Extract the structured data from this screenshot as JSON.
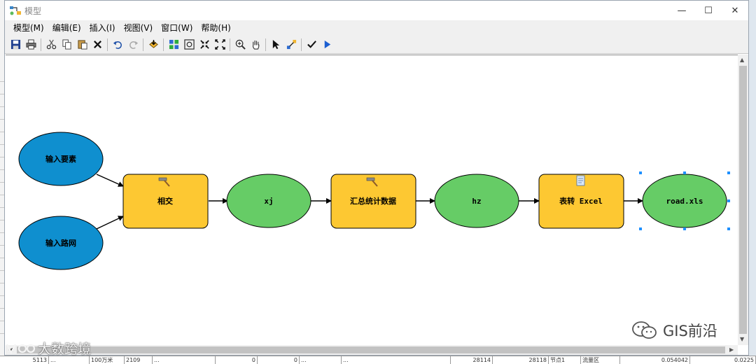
{
  "window": {
    "title": "模型",
    "minimize": "—",
    "maximize": "☐",
    "close": "✕"
  },
  "menu": [
    "模型(M)",
    "编辑(E)",
    "插入(I)",
    "视图(V)",
    "窗口(W)",
    "帮助(H)"
  ],
  "toolbar": {
    "groups": [
      [
        "save-icon",
        "print-icon"
      ],
      [
        "cut-icon",
        "copy-icon",
        "paste-icon",
        "delete-icon"
      ],
      [
        "undo-icon",
        "redo-icon"
      ],
      [
        "add-data-icon"
      ],
      [
        "auto-layout-icon",
        "full-extent-icon",
        "fixed-zoom-in-icon",
        "fixed-zoom-out-icon"
      ],
      [
        "zoom-in-icon",
        "pan-icon"
      ],
      [
        "select-icon",
        "connect-icon"
      ],
      [
        "validate-icon",
        "run-icon"
      ]
    ]
  },
  "colors": {
    "input_blue": "#0f8fcf",
    "tool_orange": "#fdc832",
    "output_green": "#66cc66",
    "selection": "#1e90ff"
  },
  "model": {
    "inputs": [
      "输入要素",
      "输入路网"
    ],
    "tools": [
      "相交",
      "汇总统计数据",
      "表转 Excel"
    ],
    "outputs": [
      "xj",
      "hz",
      "road.xls"
    ]
  },
  "watermarks": {
    "wechat": "GIS前沿",
    "brand": "大数跨境"
  },
  "background_table": [
    "5113",
    "...",
    "100万米",
    "2109",
    "...",
    "0",
    "0",
    "...",
    "...",
    "28114",
    "28118",
    "节点1",
    "流量区",
    "0.054042",
    "0.0225"
  ]
}
